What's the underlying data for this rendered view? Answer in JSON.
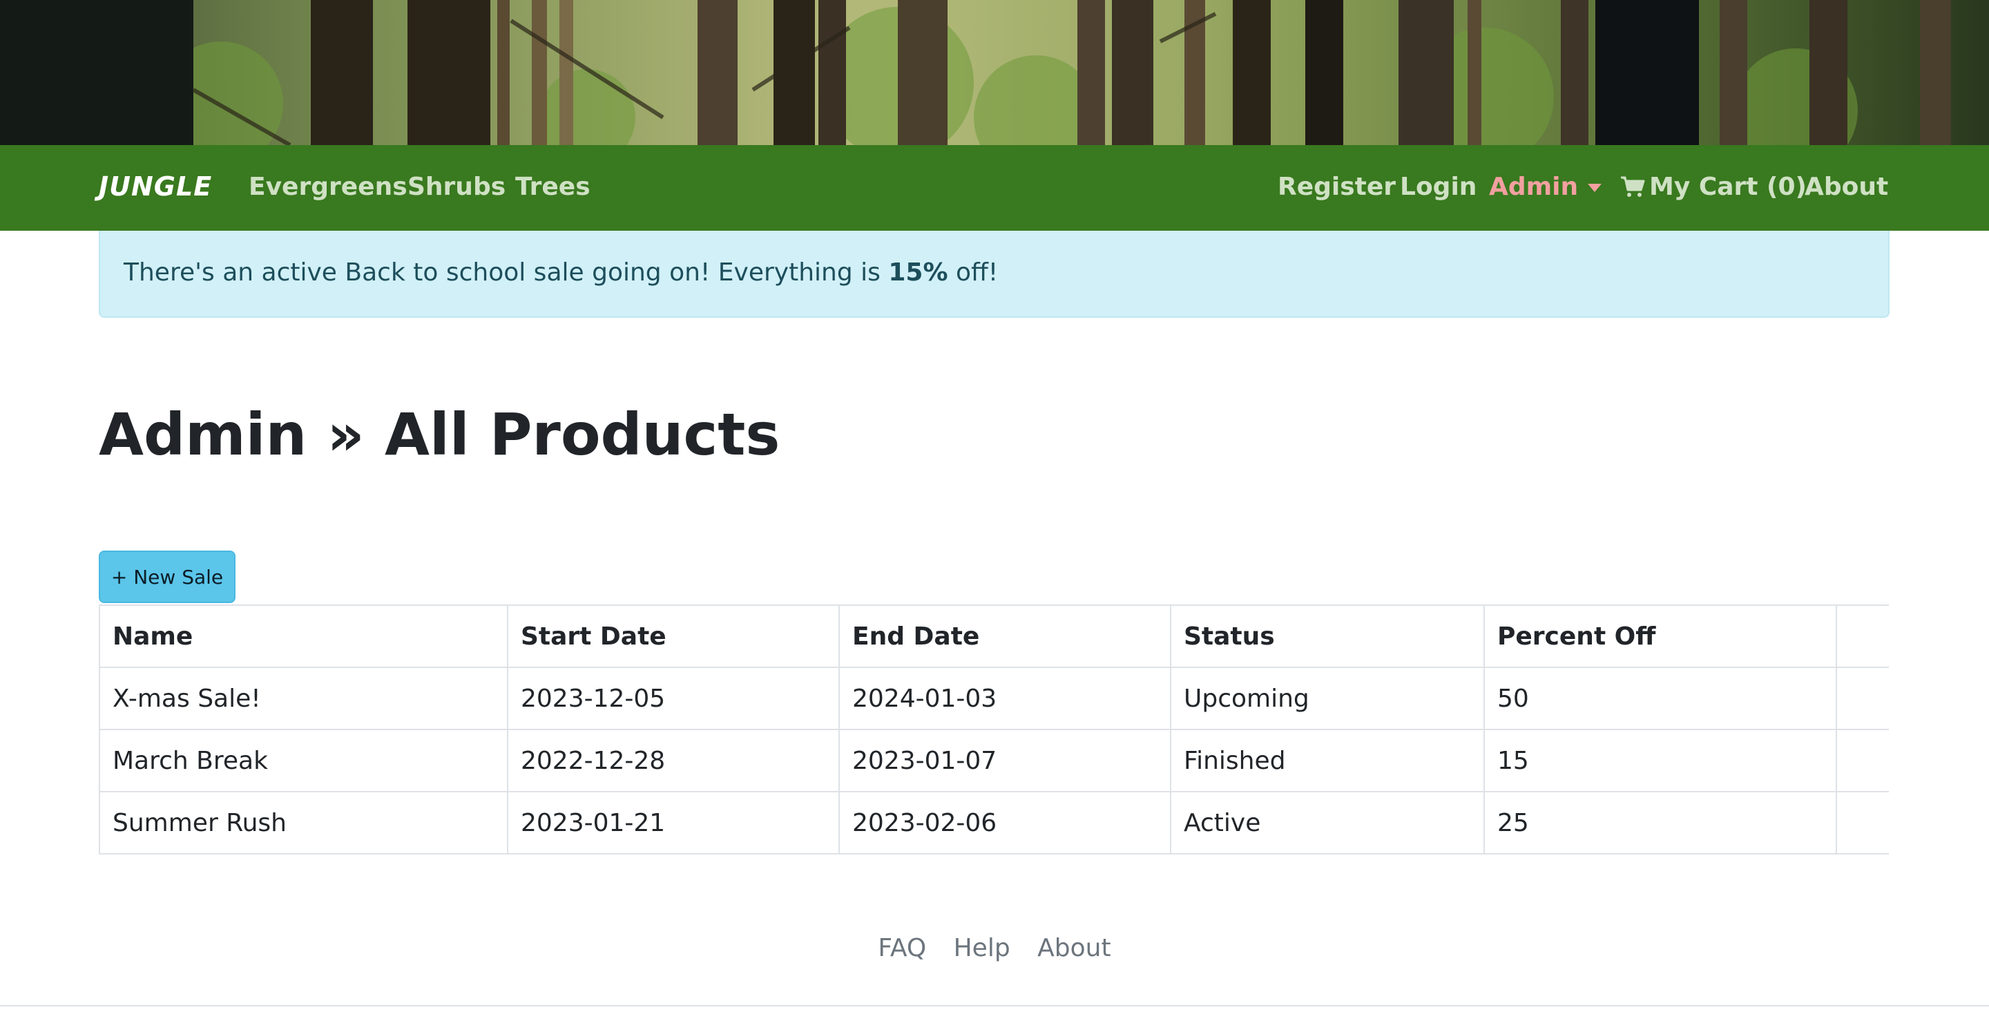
{
  "navbar": {
    "brand": "JUNGLE",
    "left_links": [
      "Evergreens",
      "Shrubs",
      "Trees"
    ],
    "right_links": {
      "register": "Register",
      "login": "Login",
      "admin": "Admin",
      "cart": "My Cart (0)",
      "about": "About"
    }
  },
  "alert": {
    "prefix": "There's an active Back to school sale going on! Everything is ",
    "percent": "15%",
    "suffix": " off!"
  },
  "page_title": "Admin » All Products",
  "new_sale_button": "+ New Sale",
  "table": {
    "headers": [
      "Name",
      "Start Date",
      "End Date",
      "Status",
      "Percent Off"
    ],
    "rows": [
      [
        "X-mas Sale!",
        "2023-12-05",
        "2024-01-03",
        "Upcoming",
        "50"
      ],
      [
        "March Break",
        "2022-12-28",
        "2023-01-07",
        "Finished",
        "15"
      ],
      [
        "Summer Rush",
        "2023-01-21",
        "2023-02-06",
        "Active",
        "25"
      ]
    ]
  },
  "footer": {
    "links": [
      "FAQ",
      "Help",
      "About"
    ]
  },
  "colors": {
    "navbar": "#39791f",
    "alert_bg": "#d1f0f8",
    "button_bg": "#5bc5ea",
    "admin_link": "#f2a0a0"
  }
}
